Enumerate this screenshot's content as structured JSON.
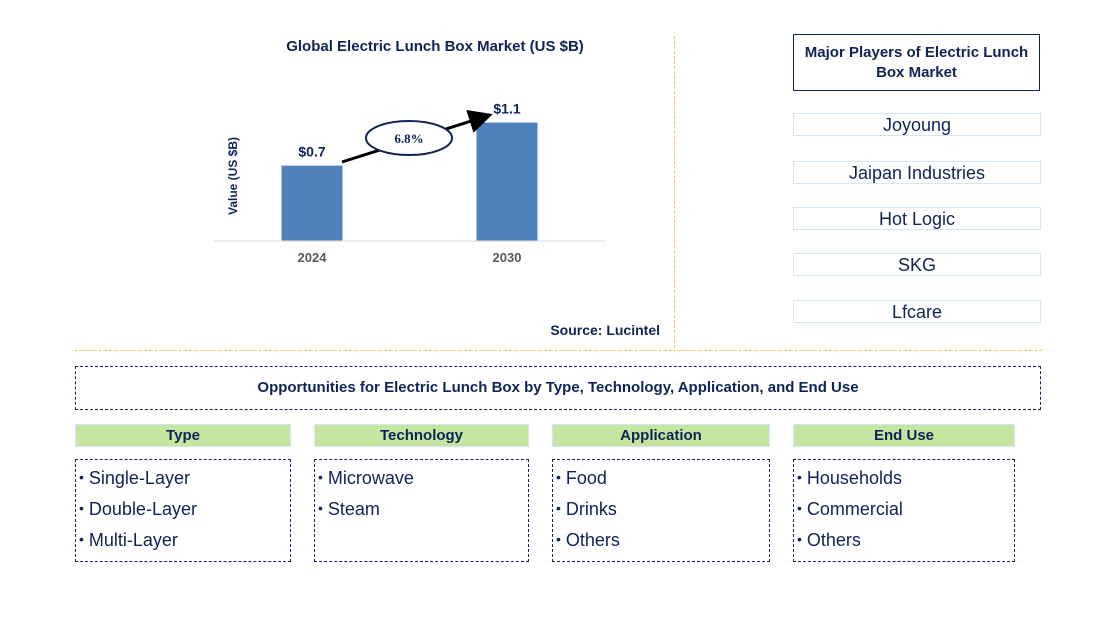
{
  "chart_data": {
    "type": "bar",
    "title": "Global Electric Lunch Box Market (US $B)",
    "xlabel": "",
    "ylabel": "Value (US $B)",
    "categories": [
      "2024",
      "2030"
    ],
    "values": [
      0.7,
      1.1
    ],
    "data_labels": [
      "$0.7",
      "$1.1"
    ],
    "ylim": [
      0,
      1.3
    ],
    "grid": false,
    "bar_color": "#4f81bd",
    "annotation": {
      "type": "cagr-arrow",
      "label": "6.8%"
    },
    "source": "Source: Lucintel"
  },
  "players": {
    "title": "Major Players of Electric Lunch Box Market",
    "items": [
      "Joyoung",
      "Jaipan Industries",
      "Hot Logic",
      "SKG",
      "Lfcare"
    ]
  },
  "opportunities": {
    "title": "Opportunities for Electric Lunch Box by Type, Technology, Application, and End Use",
    "segments": [
      {
        "header": "Type",
        "items": [
          "Single-Layer",
          "Double-Layer",
          "Multi-Layer"
        ]
      },
      {
        "header": "Technology",
        "items": [
          "Microwave",
          "Steam"
        ]
      },
      {
        "header": "Application",
        "items": [
          "Food",
          "Drinks",
          "Others"
        ]
      },
      {
        "header": "End Use",
        "items": [
          "Households",
          "Commercial",
          "Others"
        ]
      }
    ]
  },
  "colors": {
    "text": "#0f2356",
    "bar": "#4f81bd",
    "segment_header": "#c6e5a0",
    "separator": "#f5c243"
  }
}
